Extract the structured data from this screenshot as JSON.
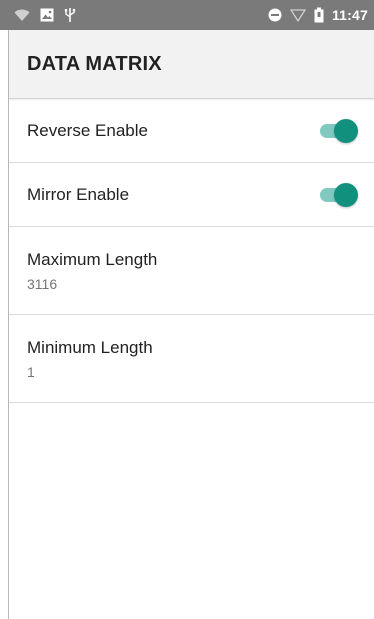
{
  "status_bar": {
    "time": "11:47",
    "icons": [
      "wifi-icon",
      "image-icon",
      "usb-icon",
      "do-not-disturb-icon",
      "signal-icon",
      "battery-icon"
    ]
  },
  "app_bar": {
    "title": "DATA MATRIX"
  },
  "settings": {
    "reverse": {
      "label": "Reverse Enable",
      "enabled": true
    },
    "mirror": {
      "label": "Mirror Enable",
      "enabled": true
    },
    "max_length": {
      "label": "Maximum Length",
      "value": "3116"
    },
    "min_length": {
      "label": "Minimum Length",
      "value": "1"
    }
  },
  "colors": {
    "status_bar": "#7a7a7a",
    "app_bar": "#f2f2f2",
    "switch_thumb": "#12907e",
    "switch_track": "#7fc9c0"
  }
}
